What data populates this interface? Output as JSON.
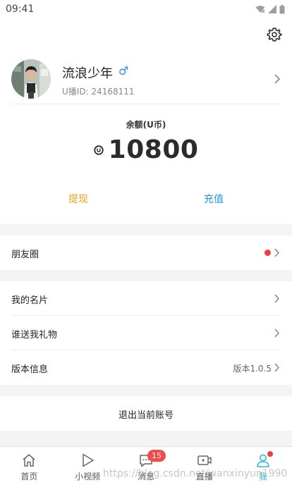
{
  "status_bar": {
    "time": "09:41"
  },
  "profile": {
    "nickname": "流浪少年",
    "gender_symbol": "♂",
    "uid": "U播ID: 24168111"
  },
  "balance": {
    "label": "余额(U币)",
    "amount": "10800",
    "withdraw_label": "提现",
    "recharge_label": "充值"
  },
  "menu": {
    "moments": "朋友圈",
    "my_card": "我的名片",
    "gifts": "谁送我礼物",
    "version_label": "版本信息",
    "version_value": "版本1.0.5"
  },
  "logout_label": "退出当前账号",
  "tabs": [
    {
      "label": "首页",
      "icon": "home-icon"
    },
    {
      "label": "小视频",
      "icon": "play-icon"
    },
    {
      "label": "消息",
      "icon": "message-icon",
      "badge": "15"
    },
    {
      "label": "直播",
      "icon": "live-camera-icon"
    },
    {
      "label": "我",
      "icon": "profile-icon"
    }
  ],
  "watermark": "https://blog.csdn.net/wanxinyun1990",
  "colors": {
    "withdraw": "#e9a520",
    "recharge": "#2196e6",
    "active_tab": "#2dbdd6",
    "badge": "#f24b4b",
    "gender": "#2c8ddc"
  }
}
